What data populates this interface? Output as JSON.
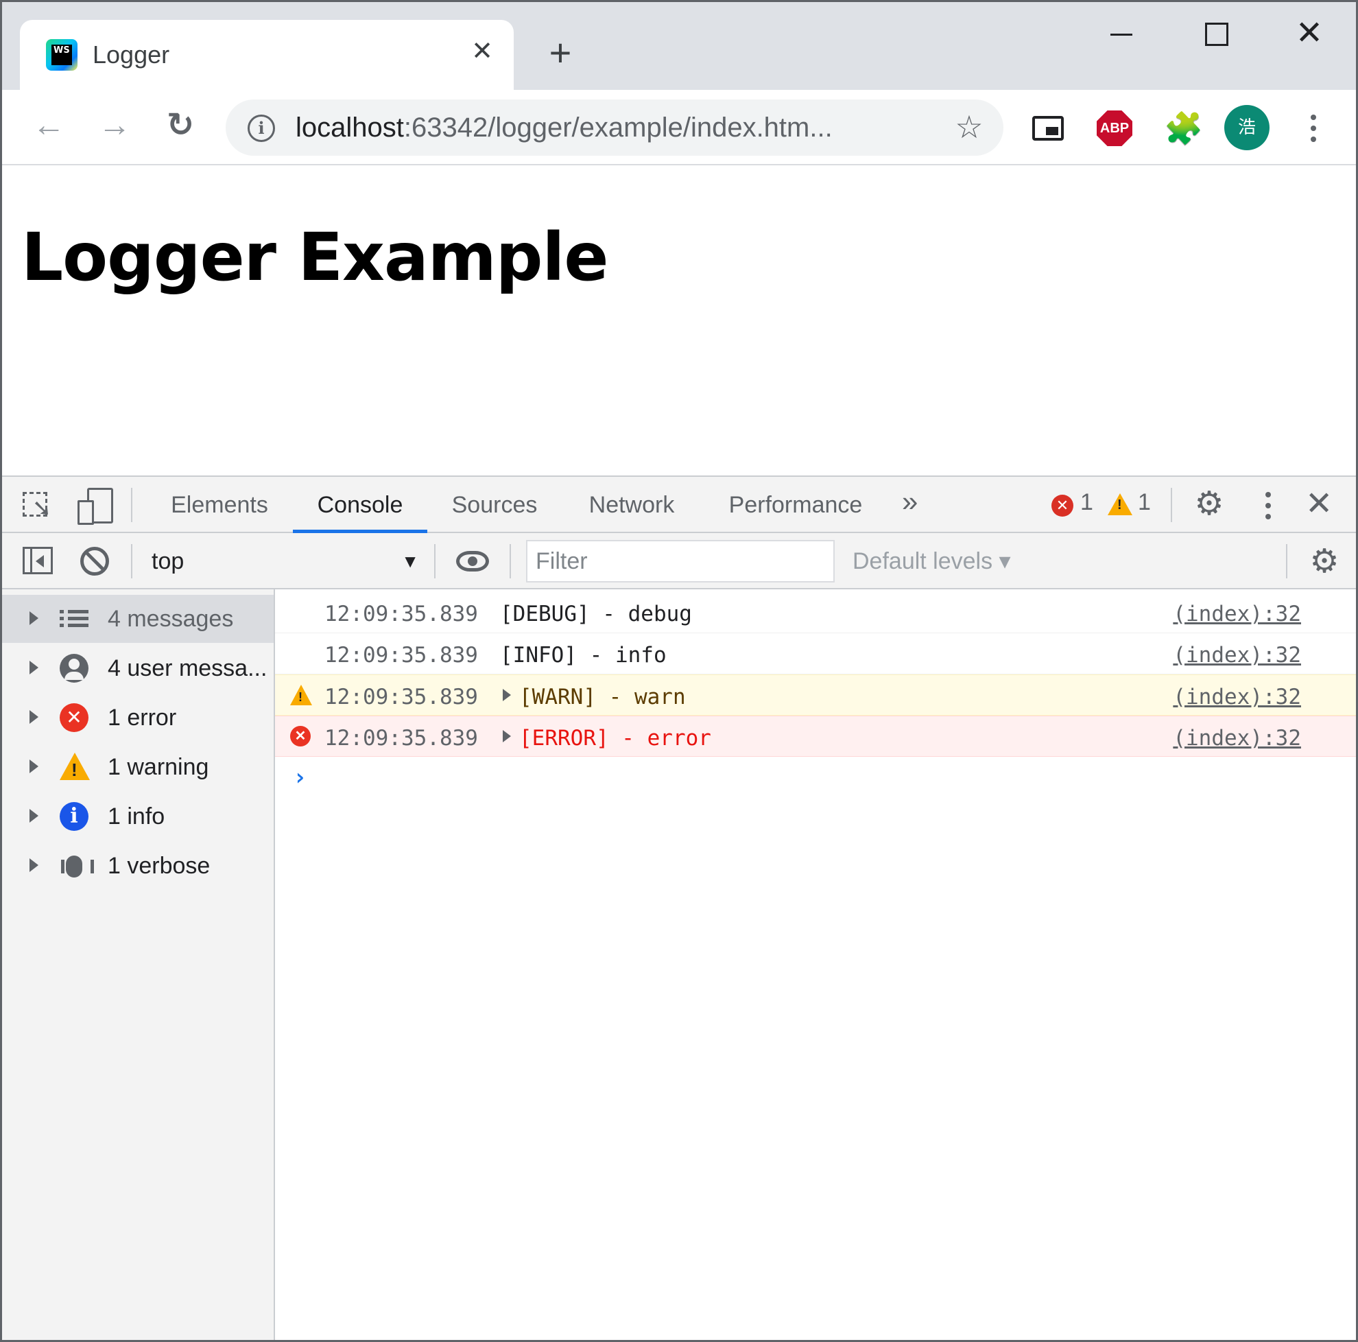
{
  "browser": {
    "tab_title": "Logger",
    "tab_close": "✕",
    "new_tab": "+",
    "favicon_text": "WS",
    "url_host": "localhost",
    "url_rest": ":63342/logger/example/index.htm...",
    "avatar_text": "浩",
    "abp_label": "ABP",
    "back_glyph": "←",
    "forward_glyph": "→",
    "reload_glyph": "↻",
    "star_glyph": "☆",
    "info_glyph": "i",
    "puzzle_glyph": "🧩",
    "close_glyph": "✕"
  },
  "page": {
    "heading": "Logger Example"
  },
  "devtools": {
    "tabs": [
      {
        "label": "Elements"
      },
      {
        "label": "Console"
      },
      {
        "label": "Sources"
      },
      {
        "label": "Network"
      },
      {
        "label": "Performance"
      }
    ],
    "active_tab": "Console",
    "more_tabs_glyph": "»",
    "error_count": "1",
    "warning_count": "1",
    "gear_glyph": "⚙",
    "close_glyph": "✕",
    "console": {
      "context": "top",
      "context_arrow": "▼",
      "filter_placeholder": "Filter",
      "levels_label": "Default levels ▾",
      "sidebar": [
        {
          "label": "4 messages",
          "icon": "list-icon"
        },
        {
          "label": "4 user messa...",
          "icon": "user-icon"
        },
        {
          "label": "1 error",
          "icon": "error-icon"
        },
        {
          "label": "1 warning",
          "icon": "warning-icon"
        },
        {
          "label": "1 info",
          "icon": "info-icon"
        },
        {
          "label": "1 verbose",
          "icon": "bug-icon"
        }
      ],
      "messages": [
        {
          "time": "12:09:35.839",
          "text": "[DEBUG] - debug",
          "source": "(index):32",
          "level": "debug"
        },
        {
          "time": "12:09:35.839",
          "text": "[INFO] - info",
          "source": "(index):32",
          "level": "info"
        },
        {
          "time": "12:09:35.839",
          "text": "[WARN] - warn",
          "source": "(index):32",
          "level": "warn"
        },
        {
          "time": "12:09:35.839",
          "text": "[ERROR] - error",
          "source": "(index):32",
          "level": "error"
        }
      ],
      "prompt_glyph": "›",
      "error_glyph": "✕",
      "info_glyph": "i"
    }
  },
  "colors": {
    "accent": "#1a73e8",
    "error": "#ea3323",
    "warning": "#f9ab00",
    "avatar": "#0b8a74"
  }
}
